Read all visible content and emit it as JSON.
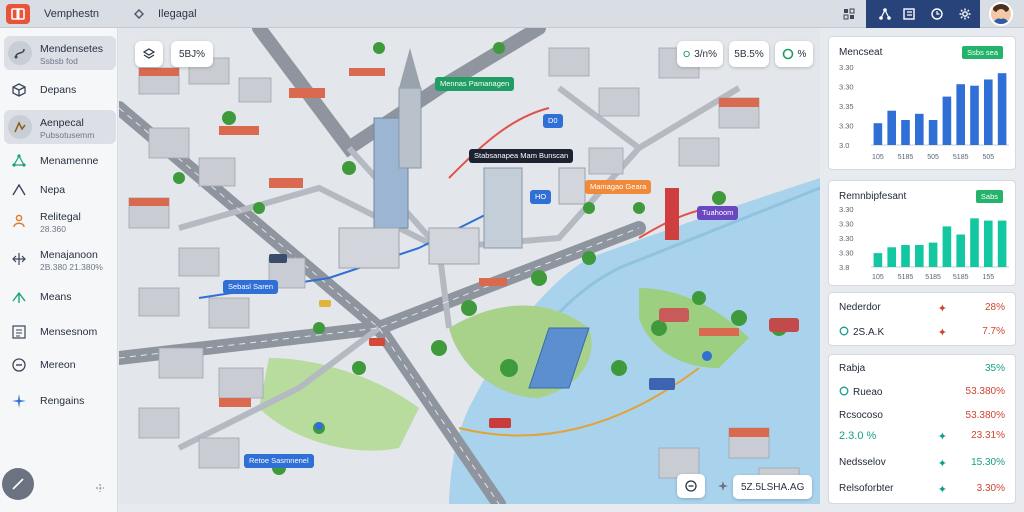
{
  "app": {
    "title": "Vemphestn",
    "breadcrumb": "Ilegagal"
  },
  "colors": {
    "accent": "#27437a",
    "brand": "#e8533a",
    "bar_blue": "#2f6fd6",
    "bar_teal": "#13c8a0",
    "alert_red": "#d0452f",
    "teal_text": "#139e87"
  },
  "sidebar": {
    "items": [
      {
        "label": "Mendensetes",
        "sub": "Ssbsb fod",
        "icon": "route-icon"
      },
      {
        "label": "Depans",
        "sub": "",
        "icon": "cube-icon"
      },
      {
        "label": "Aenpecal",
        "sub": "Pubsotusemm",
        "icon": "route-icon"
      },
      {
        "label": "Menamenne",
        "sub": "",
        "icon": "network-icon"
      },
      {
        "label": "Nepa",
        "sub": "",
        "icon": "triangle-icon"
      },
      {
        "label": "Relitegal",
        "sub": "28.360",
        "icon": "person-icon"
      },
      {
        "label": "Menajanoon",
        "sub": "2B.380 21.380%",
        "icon": "arrows-icon"
      },
      {
        "label": "Means",
        "sub": "",
        "icon": "share-icon"
      },
      {
        "label": "Mensesnom",
        "sub": "",
        "icon": "list-icon"
      },
      {
        "label": "Mereon",
        "sub": "",
        "icon": "minus-circle-icon"
      },
      {
        "label": "Rengains",
        "sub": "",
        "icon": "star-icon"
      }
    ]
  },
  "map": {
    "controls": {
      "zoom": "5BJ%",
      "stat_a": "3/n%",
      "stat_b": "5B.5%",
      "stat_c": "%",
      "scale": "5Z.5LSHA.AG"
    },
    "labels": [
      "Mennas Pamanagen",
      "D0",
      "Stabsanapea Mam Bunscan",
      "Sebasl Saren",
      "HO",
      "Mamagao Geara",
      "Tuahoom",
      "Retoe Sasmnenel"
    ]
  },
  "panels": {
    "panel1": {
      "title": "Mencseat",
      "badge": "Ssbs sea"
    },
    "panel2": {
      "title": "Remnbipfesant",
      "badge": "Sabs"
    },
    "panel3": {
      "rows": [
        {
          "label": "Nederdor",
          "value": "28%"
        },
        {
          "label": "2S.A.K",
          "value": "7.7%"
        }
      ]
    },
    "panel4": {
      "rows": [
        {
          "label": "Rabja",
          "value": "35%"
        },
        {
          "label": "Rueao",
          "value": "53.380%"
        },
        {
          "label": "Rcsocoso",
          "value": "53.380%"
        },
        {
          "label": "2.3.0 %",
          "value": "23.31%"
        },
        {
          "label": "Nedsselov",
          "value": "15.30%"
        },
        {
          "label": "Relsoforbter",
          "value": "3.30%"
        }
      ]
    }
  },
  "chart_data": [
    {
      "type": "bar",
      "title": "Mencseat",
      "categories": [
        "105",
        "105",
        "5185",
        "1185",
        "505",
        "1185",
        "5185",
        "5185",
        "505",
        "555"
      ],
      "values": [
        1.4,
        2.2,
        1.6,
        2.0,
        1.6,
        3.1,
        3.9,
        3.8,
        4.2,
        4.6
      ],
      "yticks": [
        "3.30",
        "3.30",
        "3.35",
        "3.30",
        "3.0"
      ],
      "ylim": [
        0,
        5
      ],
      "color": "#2f6fd6"
    },
    {
      "type": "bar",
      "title": "Remnbipfesant",
      "categories": [
        "105",
        "5185",
        "5185",
        "5185",
        "5185",
        "505",
        "5185",
        "5185",
        "155",
        "9185"
      ],
      "values": [
        1.2,
        1.7,
        1.9,
        1.9,
        2.1,
        3.5,
        2.8,
        4.2,
        4.0,
        4.0
      ],
      "yticks": [
        "3.30",
        "3.30",
        "3.30",
        "3.30",
        "3.8"
      ],
      "ylim": [
        0,
        5
      ],
      "color": "#13c8a0"
    }
  ]
}
